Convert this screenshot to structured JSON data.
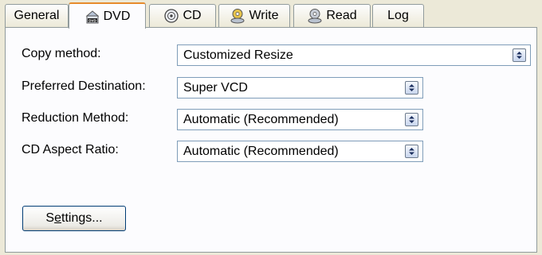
{
  "tabs": [
    {
      "label": "General",
      "icon": "none",
      "active": false
    },
    {
      "label": "DVD",
      "icon": "dvd-icon",
      "active": true
    },
    {
      "label": "CD",
      "icon": "cd-icon",
      "active": false
    },
    {
      "label": "Write",
      "icon": "write-icon",
      "active": false
    },
    {
      "label": "Read",
      "icon": "read-icon",
      "active": false
    },
    {
      "label": "Log",
      "icon": "none",
      "active": false
    }
  ],
  "fields": {
    "copy_method": {
      "label": "Copy method:",
      "value": "Customized Resize"
    },
    "preferred_destination": {
      "label": "Preferred Destination:",
      "value": "Super VCD"
    },
    "reduction_method": {
      "label": "Reduction Method:",
      "value": "Automatic (Recommended)"
    },
    "cd_aspect_ratio": {
      "label": "CD Aspect Ratio:",
      "value": "Automatic (Recommended)"
    }
  },
  "settings_button": {
    "label_pre": "S",
    "label_accel": "e",
    "label_post": "ttings..."
  },
  "colors": {
    "accent": "#e68b2c",
    "border": "#919b9c",
    "panel": "#fcfcfe"
  }
}
